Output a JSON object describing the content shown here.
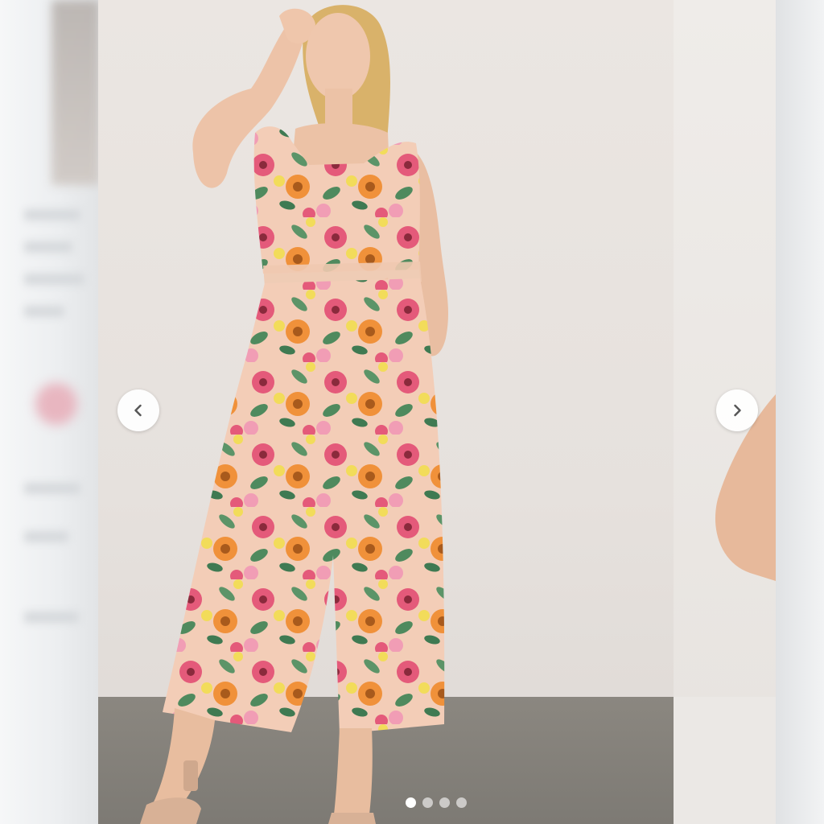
{
  "carousel": {
    "prev_icon": "chevron-left-icon",
    "next_icon": "chevron-right-icon",
    "slide_count": 4,
    "active_slide": 1
  },
  "photo": {
    "subject": "model-wearing-floral-jumpsuit"
  },
  "colors": {
    "backdrop": "#e8e3df",
    "floor": "#85817b",
    "fabric_base": "#f3cdb7",
    "flower_pink": "#e45a7a",
    "flower_orange": "#f0913a",
    "flower_yellow": "#f2dc5a",
    "leaf_green": "#4f8a5e"
  }
}
